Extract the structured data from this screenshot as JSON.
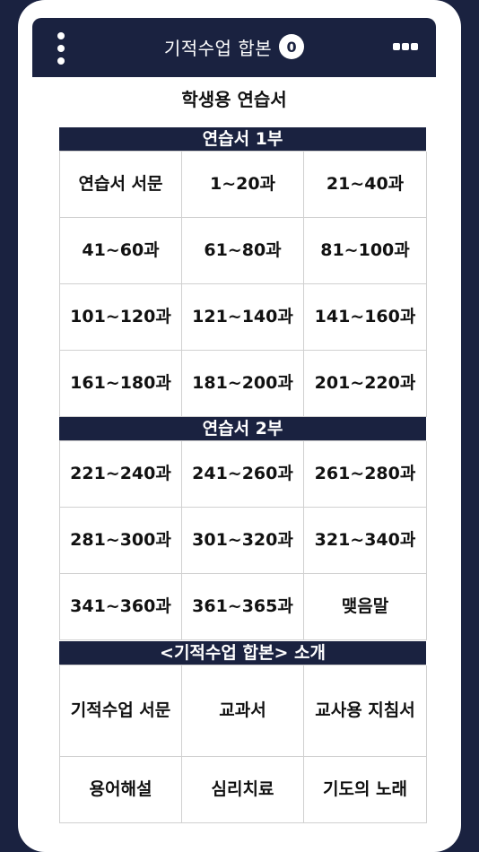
{
  "header": {
    "title": "기적수업 합본",
    "badge_count": "0"
  },
  "page_title": "학생용 연습서",
  "sections": [
    {
      "title": "연습서 1부",
      "items": [
        "연습서 서문",
        "1~20과",
        "21~40과",
        "41~60과",
        "61~80과",
        "81~100과",
        "101~120과",
        "121~140과",
        "141~160과",
        "161~180과",
        "181~200과",
        "201~220과"
      ]
    },
    {
      "title": "연습서 2부",
      "items": [
        "221~240과",
        "241~260과",
        "261~280과",
        "281~300과",
        "301~320과",
        "321~340과",
        "341~360과",
        "361~365과",
        "맺음말"
      ]
    },
    {
      "title": "<기적수업 합본> 소개",
      "items": [
        "기적수업 서문",
        "교과서",
        "교사용 지침서",
        "용어해설",
        "심리치료",
        "기도의 노래"
      ]
    }
  ],
  "colors": {
    "navy": "#1a2240",
    "border": "#d0d0d0"
  }
}
